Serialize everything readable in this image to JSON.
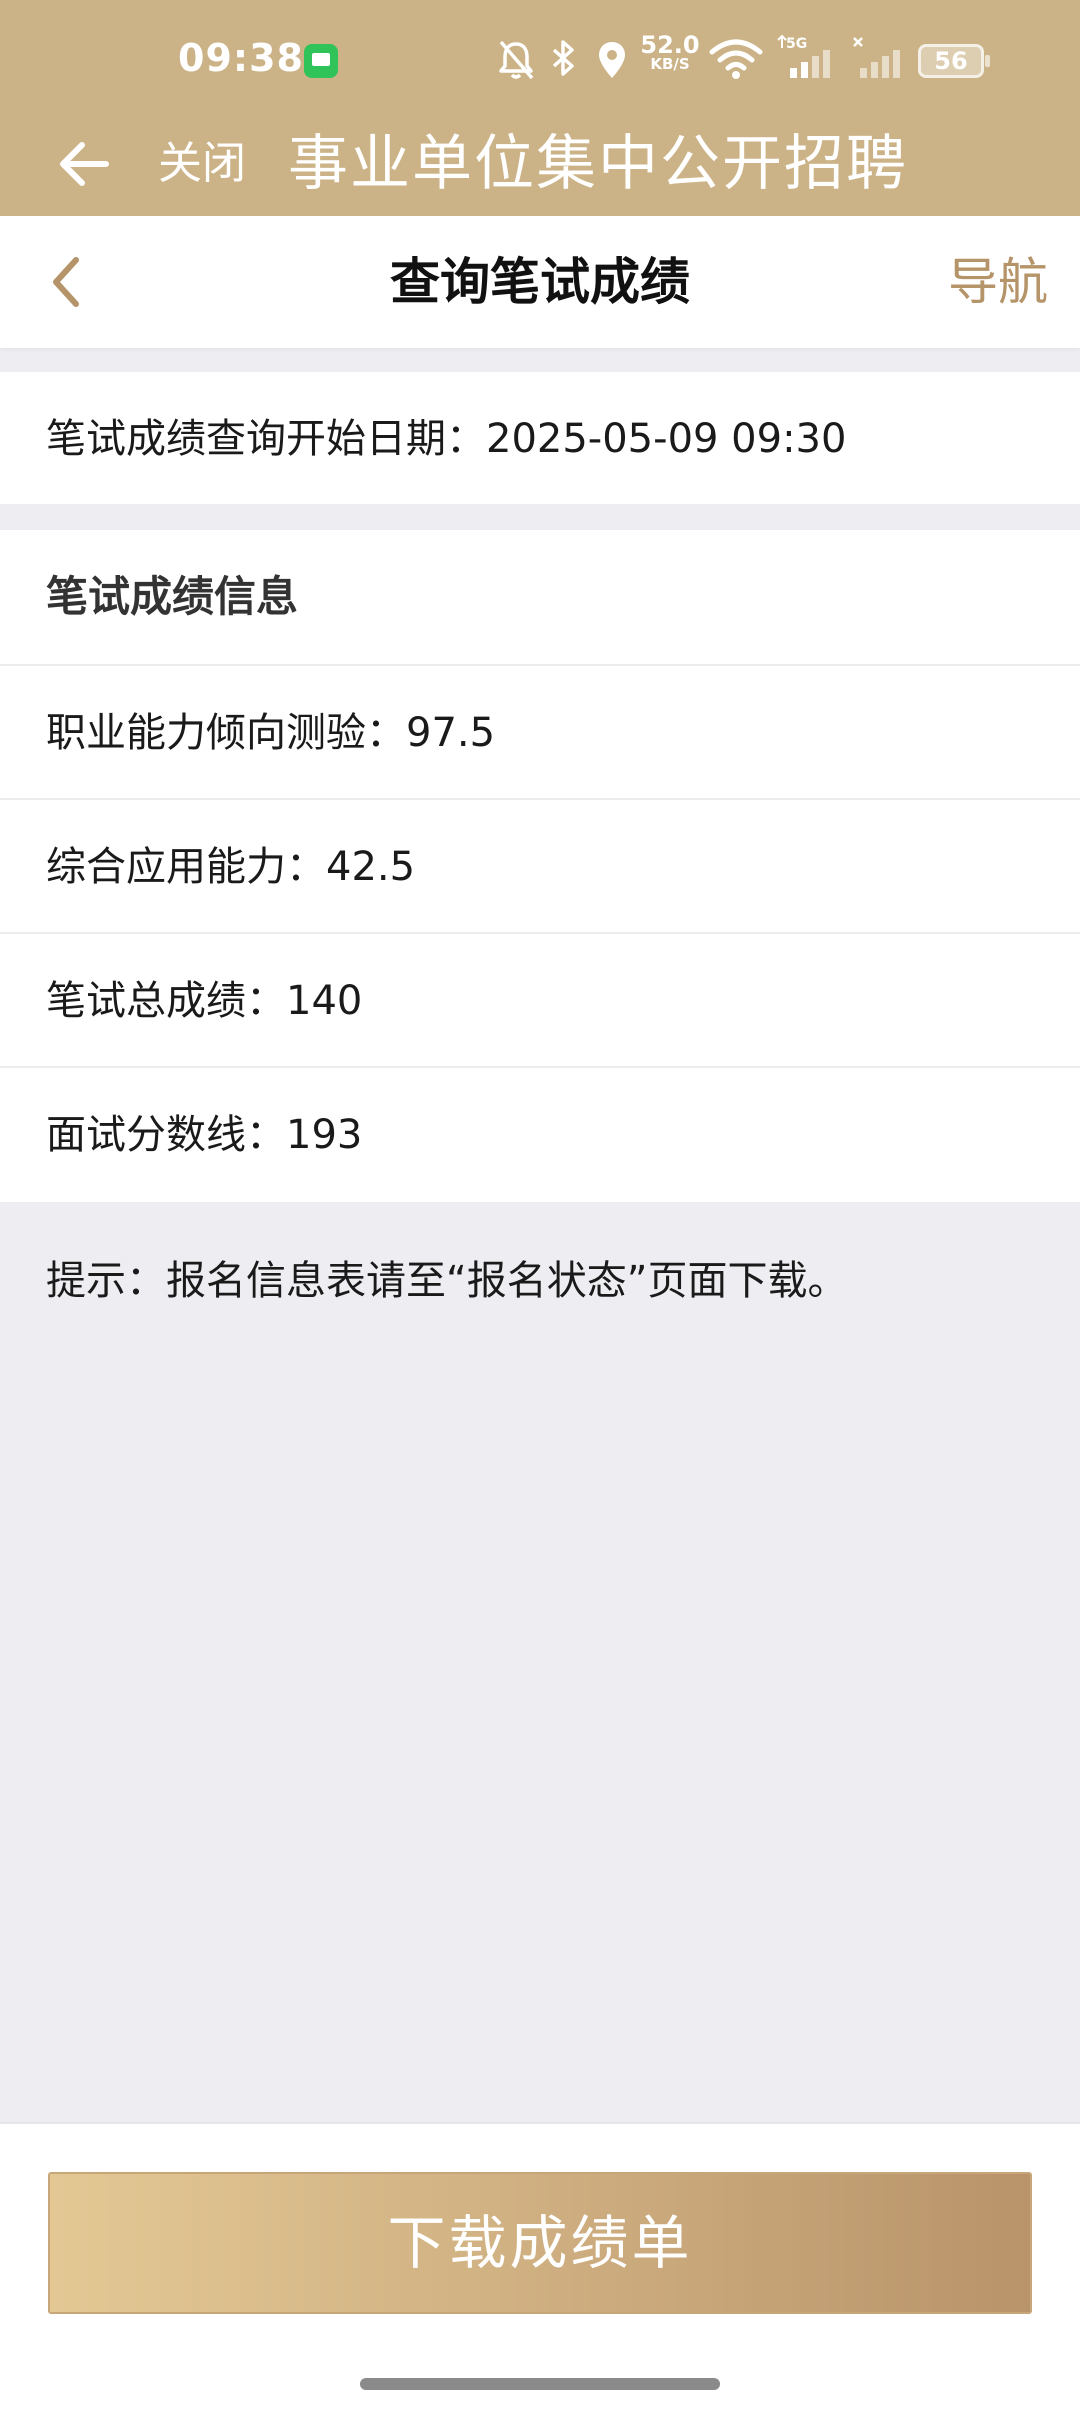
{
  "status_bar": {
    "time": "09:38",
    "net_speed": "52.0",
    "net_speed_unit": "KB/S",
    "signal_label": "5G",
    "battery": "56",
    "icons": [
      "message-icon",
      "mute-bell-icon",
      "bluetooth-icon",
      "location-icon",
      "wifi-icon",
      "signal-icon",
      "signal-icon-no-service",
      "battery-icon"
    ]
  },
  "app_header": {
    "close_label": "关闭",
    "title": "事业单位集中公开招聘"
  },
  "nav": {
    "title": "查询笔试成绩",
    "guide_label": "导航"
  },
  "query_date": {
    "label": "笔试成绩查询开始日期：",
    "value": "2025-05-09 09:30"
  },
  "scores": {
    "section_title": "笔试成绩信息",
    "rows": [
      {
        "label": "职业能力倾向测验：",
        "value": "97.5"
      },
      {
        "label": "综合应用能力：",
        "value": "42.5"
      },
      {
        "label": "笔试总成绩：",
        "value": "140"
      },
      {
        "label": "面试分数线：",
        "value": "193"
      }
    ]
  },
  "tip": "提示：报名信息表请至“报名状态”页面下载。",
  "download_button": "下载成绩单",
  "colors": {
    "header_gold": "#cbb387",
    "accent_brown": "#b49468",
    "button_gradient_start": "#e3c894",
    "button_gradient_end": "#b9936a",
    "page_bg": "#eeeef2"
  }
}
